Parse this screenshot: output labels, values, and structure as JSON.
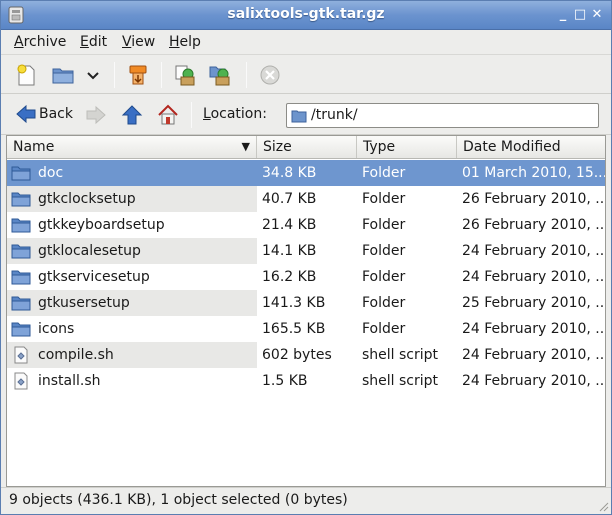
{
  "window": {
    "title": "salixtools-gtk.tar.gz",
    "controls": {
      "minimize": "_",
      "maximize": "□",
      "close": "✕"
    }
  },
  "menubar": {
    "items": [
      {
        "label": "Archive",
        "key": "A",
        "rest": "rchive"
      },
      {
        "label": "Edit",
        "key": "E",
        "rest": "dit"
      },
      {
        "label": "View",
        "key": "V",
        "rest": "iew"
      },
      {
        "label": "Help",
        "key": "H",
        "rest": "elp"
      }
    ]
  },
  "toolbar": {
    "icons": [
      "new-archive-icon",
      "open-archive-icon",
      "open-dropdown-icon",
      "extract-icon",
      "add-files-icon",
      "add-folder-icon",
      "stop-icon"
    ]
  },
  "locationbar": {
    "back_label": "Back",
    "location_label": "Location:",
    "location_key": "L",
    "location_rest": "ocation:",
    "location_value": "/trunk/"
  },
  "columns": {
    "name": "Name",
    "size": "Size",
    "type": "Type",
    "date": "Date Modified"
  },
  "files": [
    {
      "name": "doc",
      "size": "34.8 KB",
      "type": "Folder",
      "date": "01 March 2010, 15...",
      "icon": "folder-icon",
      "selected": true
    },
    {
      "name": "gtkclocksetup",
      "size": "40.7 KB",
      "type": "Folder",
      "date": "26 February 2010, ...",
      "icon": "folder-icon"
    },
    {
      "name": "gtkkeyboardsetup",
      "size": "21.4 KB",
      "type": "Folder",
      "date": "26 February 2010, ...",
      "icon": "folder-icon"
    },
    {
      "name": "gtklocalesetup",
      "size": "14.1 KB",
      "type": "Folder",
      "date": "24 February 2010, ...",
      "icon": "folder-icon"
    },
    {
      "name": "gtkservicesetup",
      "size": "16.2 KB",
      "type": "Folder",
      "date": "24 February 2010, ...",
      "icon": "folder-icon"
    },
    {
      "name": "gtkusersetup",
      "size": "141.3 KB",
      "type": "Folder",
      "date": "25 February 2010, ...",
      "icon": "folder-icon"
    },
    {
      "name": "icons",
      "size": "165.5 KB",
      "type": "Folder",
      "date": "24 February 2010, ...",
      "icon": "folder-icon"
    },
    {
      "name": "compile.sh",
      "size": "602 bytes",
      "type": "shell script",
      "date": "24 February 2010, ...",
      "icon": "script-file-icon"
    },
    {
      "name": "install.sh",
      "size": "1.5 KB",
      "type": "shell script",
      "date": "24 February 2010, ...",
      "icon": "script-file-icon"
    }
  ],
  "statusbar": {
    "text": "9 objects (436.1 KB), 1 object selected (0 bytes)"
  },
  "colors": {
    "selection": "#6e96cf",
    "titlebar": "#6b93cf"
  }
}
